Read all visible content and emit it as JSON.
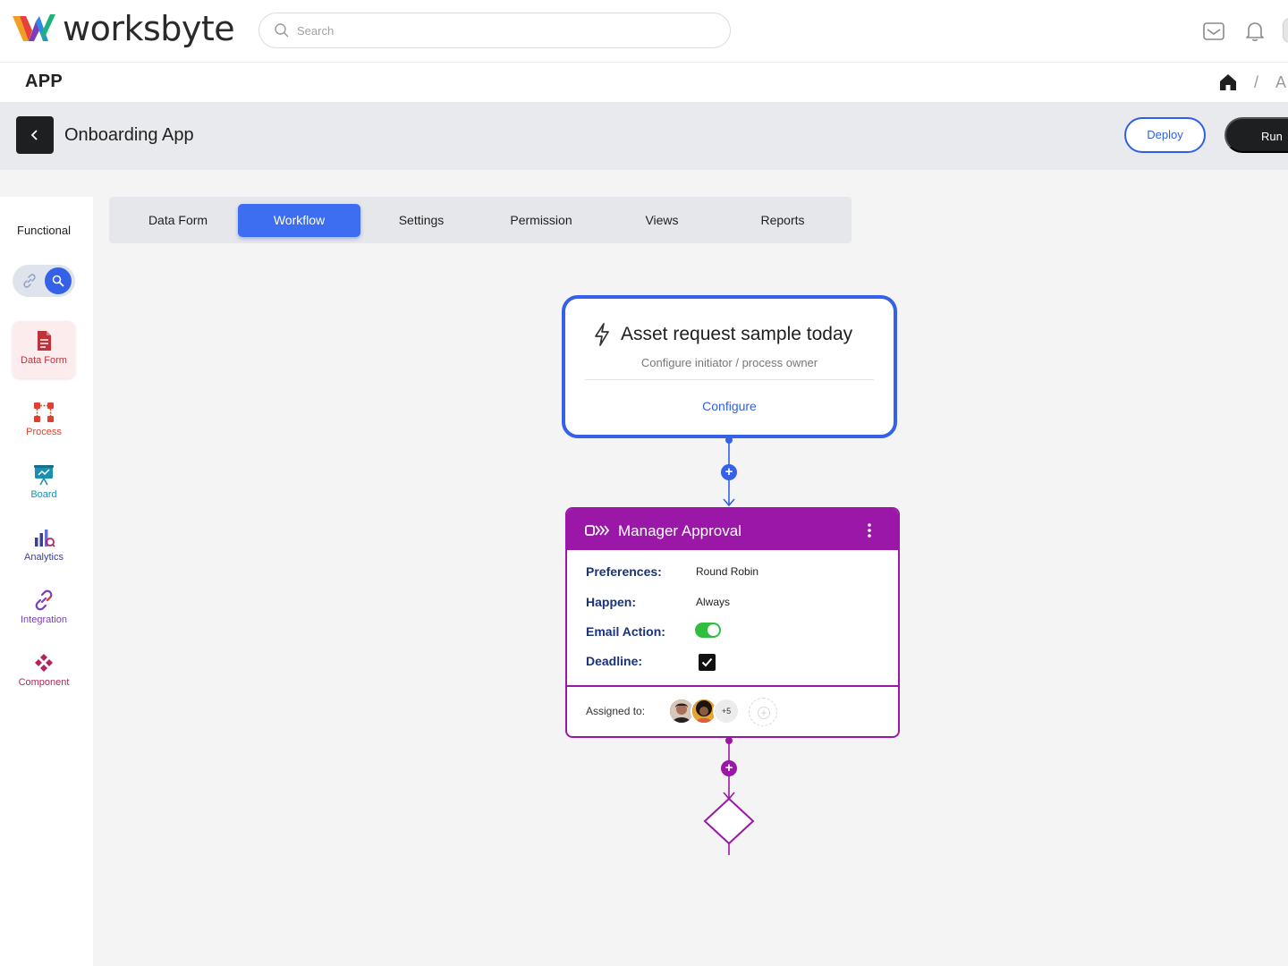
{
  "brand": {
    "name": "worksbyte"
  },
  "search": {
    "placeholder": "Search"
  },
  "header": {
    "icons": [
      "mail-icon",
      "bell-icon"
    ]
  },
  "app_row": {
    "label": "APP",
    "breadcrumb": {
      "separator": "/",
      "current": "A"
    }
  },
  "title_bar": {
    "title": "Onboarding App",
    "deploy_label": "Deploy",
    "run_label": "Run"
  },
  "sidebar": {
    "functional_label": "Functional",
    "items": [
      {
        "label": "Data Form",
        "icon": "document-icon",
        "color": "#c0313a",
        "active": true
      },
      {
        "label": "Process",
        "icon": "process-icon",
        "color": "#e0412e"
      },
      {
        "label": "Board",
        "icon": "board-icon",
        "color": "#1b8fb0"
      },
      {
        "label": "Analytics",
        "icon": "analytics-icon",
        "color": "#3a3f9e"
      },
      {
        "label": "Integration",
        "icon": "link-icon",
        "color": "#7a3fb8"
      },
      {
        "label": "Component",
        "icon": "component-icon",
        "color": "#b3245c"
      }
    ]
  },
  "tabs": [
    {
      "label": "Data Form"
    },
    {
      "label": "Workflow",
      "active": true
    },
    {
      "label": "Settings"
    },
    {
      "label": "Permission"
    },
    {
      "label": "Views"
    },
    {
      "label": "Reports"
    }
  ],
  "trigger": {
    "title": "Asset request sample today",
    "subtitle": "Configure initiator / process owner",
    "action": "Configure"
  },
  "approval": {
    "title": "Manager Approval",
    "fields": [
      {
        "label": "Preferences:",
        "value": "Round Robin"
      },
      {
        "label": "Happen:",
        "value": "Always"
      },
      {
        "label": "Email Action:",
        "value": "",
        "toggle": true
      },
      {
        "label": "Deadline:",
        "value": "",
        "checked": true
      }
    ],
    "assigned_label": "Assigned to:",
    "assignees_more": "+5"
  },
  "colors": {
    "primary": "#3560e8",
    "approval": "#9b17a8",
    "dark": "#1e1f21",
    "toggle_on": "#2fbe3e"
  }
}
